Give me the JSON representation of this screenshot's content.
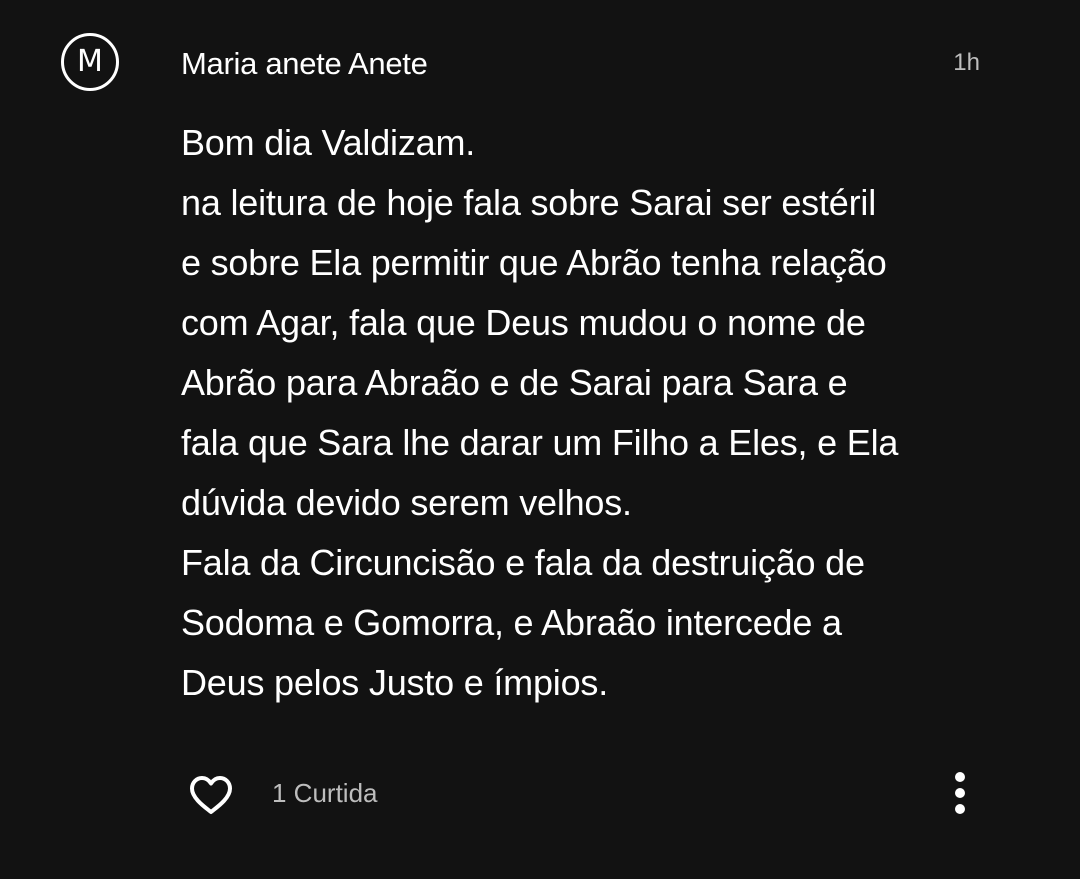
{
  "comment": {
    "avatar_initial": "M",
    "author": "Maria anete Anete",
    "timestamp": "1h",
    "body_lines": [
      "Bom dia Valdizam.",
      "na leitura de hoje fala sobre Sarai ser estéril",
      "e sobre Ela permitir que Abrão tenha relação",
      "com Agar, fala que Deus mudou o nome de",
      "Abrão para Abraão e de Sarai para Sara e",
      "fala que Sara lhe darar um Filho a Eles, e Ela",
      "dúvida devido serem velhos.",
      "Fala da Circuncisão e fala da destruição de",
      "Sodoma e Gomorra, e Abraão intercede a",
      "Deus pelos Justo e ímpios."
    ],
    "likes_label": "1 Curtida"
  },
  "icons": {
    "like": "heart-outline-icon",
    "more": "vertical-ellipsis-icon"
  },
  "colors": {
    "background": "#121212",
    "text_primary": "#ffffff",
    "text_secondary": "#bdbdbd"
  }
}
